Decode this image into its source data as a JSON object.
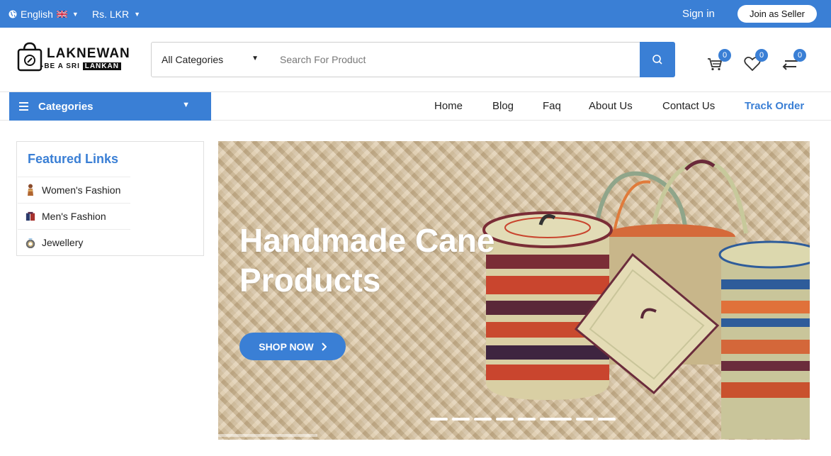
{
  "topbar": {
    "language": "English",
    "language_icon": "globe-icon",
    "flag": "uk-flag-icon",
    "currency": "Rs. LKR",
    "signin_label": "Sign in",
    "join_label": "Join as Seller"
  },
  "header": {
    "logo_word": "LAKNEWAN",
    "logo_sub_a": "-BE A SRI",
    "logo_sub_b": "LANKAN",
    "category_select": "All Categories",
    "search_placeholder": "Search For Product",
    "cart_count": "0",
    "wishlist_count": "0",
    "compare_count": "0"
  },
  "nav": {
    "categories_label": "Categories",
    "links": [
      "Home",
      "Blog",
      "Faq",
      "About Us",
      "Contact Us",
      "Track Order"
    ]
  },
  "featured": {
    "title": "Featured Links",
    "items": [
      {
        "label": "Women's Fashion",
        "icon": "womens-fashion-icon"
      },
      {
        "label": "Men's Fashion",
        "icon": "mens-fashion-icon"
      },
      {
        "label": "Jewellery",
        "icon": "ring-icon"
      }
    ]
  },
  "banner": {
    "title": "Handmade Cane Products",
    "cta": "SHOP NOW",
    "slide_count": 8,
    "active_slide": 5
  },
  "colors": {
    "accent": "#3a7fd5",
    "text": "#222222"
  }
}
